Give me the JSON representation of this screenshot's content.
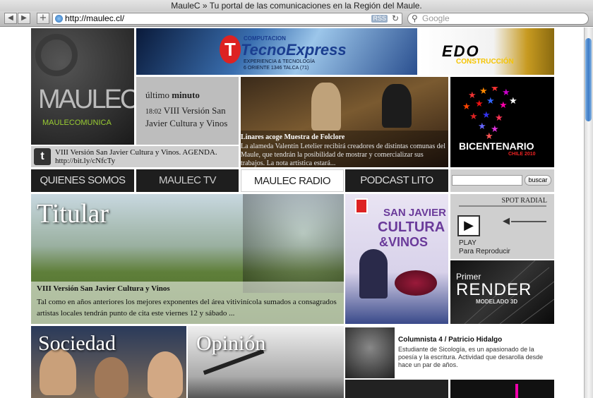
{
  "browser": {
    "title": "MauleC » Tu portal de las comunicaciones en la Región del Maule.",
    "url": "http://maulec.cl/",
    "rss_label": "RSS",
    "search_placeholder": "Google"
  },
  "logo": {
    "main": "MAULEC",
    "sub": "MAULECOMUNICA"
  },
  "banner_tecno": {
    "pre": "COMPUTACION",
    "name": "TecnoExpress",
    "line1": "EXPERIENCIA & TECNOLOGÍA",
    "line2": "6 ORIENTE 1346  TALCA (71)"
  },
  "banner_edo": {
    "name": "EDO",
    "sub": "CONSTRUCCIÓN"
  },
  "ultimo": {
    "label1": "último",
    "label2": "minuto",
    "time": "18:02",
    "headline": "VIII Versión San Javier Cultura y Vinos"
  },
  "twitter": {
    "text": "VIII Versión San Javier Cultura y Vinos. AGENDA. http://bit.ly/cNfcTy"
  },
  "folclore": {
    "title": "Linares acoge Muestra de Folclore",
    "text": "La alameda Valentín Letelier recibirá creadores de distintas comunas del Maule, que tendrán la posibilidad de mostrar y comercializar sus trabajos. La nota artística estará..."
  },
  "bicentenario": {
    "title": "BICENTENARIO",
    "sub": "CHILE 2010"
  },
  "menu": [
    "QUIENES SOMOS",
    "MAULEC TV",
    "MAULEC RADIO",
    "PODCAST LITO"
  ],
  "search_button": "buscar",
  "titular": {
    "heading": "Titular",
    "title": "VIII Versión San Javier Cultura y Vinos",
    "text": "Tal como en años anteriores los mejores exponentes del área vitivinícola sumados a consagrados artistas locales tendrán punto de cita este viernes 12 y sábado ..."
  },
  "poster": {
    "line1": "SAN JAVIER",
    "line2": "CULTURA",
    "line3": "&VINOS"
  },
  "spot": {
    "label": "SPOT RADIAL",
    "play": "PLAY",
    "sub": "Para Reproducir"
  },
  "render": {
    "pre": "Primer",
    "name": "RENDER",
    "sub": "MODELADO 3D"
  },
  "sociedad": "Sociedad",
  "opinion": "Opinión",
  "columnista": {
    "title": "Columnista 4 / Patricio Hidalgo",
    "text": "Estudiante de Sicología, es un apasionado de la poesía y la escritura. Actividad que desarolla desde hace un par de años."
  },
  "colors": {
    "accent_green": "#9acd32",
    "tecno_blue": "#1a3d8f",
    "edo_yellow": "#f5c400"
  }
}
